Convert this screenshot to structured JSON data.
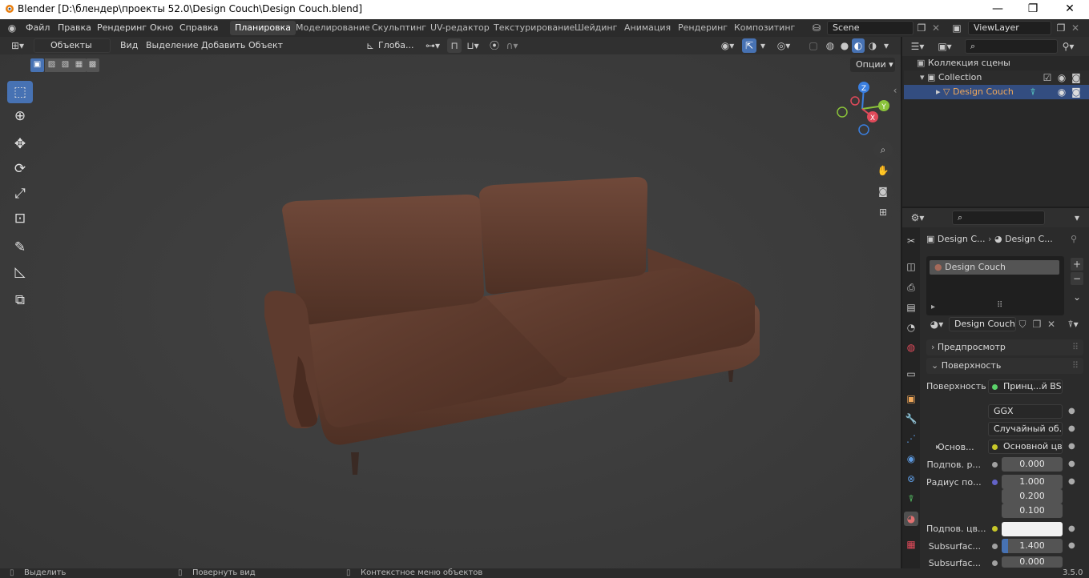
{
  "window": {
    "title": "Blender [D:\\блендер\\проекты 52.0\\Design Couch\\Design Couch.blend]",
    "controls": {
      "minimize": "—",
      "maximize": "❐",
      "close": "✕"
    }
  },
  "menu": [
    "Файл",
    "Правка",
    "Рендеринг",
    "Окно",
    "Справка"
  ],
  "workspaces": [
    "Планировка",
    "Моделирование",
    "Скульптинг",
    "UV-редактор",
    "Текстурирование",
    "Шейдинг",
    "Анимация",
    "Рендеринг",
    "Композитинг"
  ],
  "active_workspace": "Планировка",
  "scene": {
    "name": "Scene",
    "view_layer": "ViewLayer"
  },
  "viewport": {
    "mode": "Объекты",
    "menu": [
      "Вид",
      "Выделение",
      "Добавить",
      "Объект"
    ],
    "transform_orientation": "Глоба...",
    "options_label": "Опции",
    "gizmo_axes": {
      "x": "X",
      "y": "Y",
      "z": "Z"
    },
    "axis_colors": {
      "x": "#e04a5a",
      "y": "#8ac23a",
      "z": "#3a7fe0"
    }
  },
  "outliner": {
    "root": "Коллекция сцены",
    "collection": "Collection",
    "object": "Design Couch"
  },
  "properties": {
    "breadcrumb": [
      "Design C...",
      "Design C..."
    ],
    "material_slot": "Design Couch",
    "material_name": "Design Couch",
    "panel_preview": "Предпросмотр",
    "panel_surface": "Поверхность",
    "rows": {
      "surface_label": "Поверхность",
      "surface_value": "Принц...й BSDF",
      "distribution": "GGX",
      "subsurface_method": "Случайный об...",
      "base_label": "Основ...",
      "base_value": "Основной цвет",
      "subsurface_label": "Подпов. р...",
      "subsurface_value": "0.000",
      "radius_label": "Радиус по...",
      "radius_1": "1.000",
      "radius_2": "0.200",
      "radius_3": "0.100",
      "subsurface_color_label": "Подпов. цв...",
      "ior_label": "Subsurfac...",
      "ior_value": "1.400",
      "aniso_label": "Subsurfac...",
      "aniso_value": "0.000"
    }
  },
  "status": {
    "select": "Выделить",
    "rotate": "Повернуть вид",
    "context": "Контекстное меню объектов",
    "version": "3.5.0"
  },
  "colors": {
    "accent": "#4772b3",
    "sofa": "#5a3a2e"
  }
}
